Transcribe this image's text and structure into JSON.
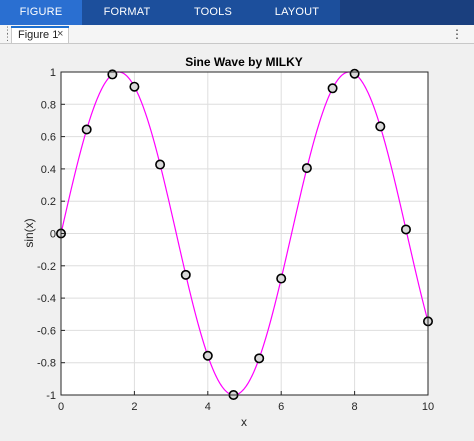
{
  "ribbon": {
    "tabs": [
      {
        "label": "FIGURE",
        "active": true
      },
      {
        "label": "FORMAT",
        "active": false
      },
      {
        "label": "TOOLS",
        "active": false
      },
      {
        "label": "LAYOUT",
        "active": false
      }
    ],
    "color": "#1c4f9c",
    "active_color": "#2a6fd1"
  },
  "document_tab": {
    "label": "Figure 1",
    "close_glyph": "×"
  },
  "menu_glyph": "⋮",
  "chart_data": {
    "type": "line",
    "title": "Sine Wave by MILKY",
    "xlabel": "x",
    "ylabel": "sin(x)",
    "xlim": [
      0,
      10
    ],
    "ylim": [
      -1,
      1
    ],
    "xticks": [
      "0",
      "2",
      "4",
      "6",
      "8",
      "10"
    ],
    "yticks": [
      "1",
      "0.8",
      "0.6",
      "0.4",
      "0.2",
      "0",
      "-0.2",
      "-0.4",
      "-0.6",
      "-0.8",
      "-1"
    ],
    "grid": true,
    "line_color": "#ff00ff",
    "marker_edge_color": "#000000",
    "marker_face_color": "#d9d9d9",
    "series": [
      {
        "type": "line",
        "function": "sin(x)",
        "x_range": [
          0,
          10
        ]
      },
      {
        "type": "scatter",
        "x": [
          0,
          0.7,
          1.4,
          2.0,
          2.7,
          3.4,
          4.0,
          4.7,
          5.4,
          6.0,
          6.7,
          7.4,
          8.0,
          8.7,
          9.4,
          10.0
        ],
        "y": [
          0,
          0.644,
          0.985,
          0.909,
          0.427,
          -0.256,
          -0.757,
          -1.0,
          -0.773,
          -0.279,
          0.405,
          0.899,
          0.989,
          0.663,
          0.025,
          -0.544
        ]
      }
    ]
  }
}
